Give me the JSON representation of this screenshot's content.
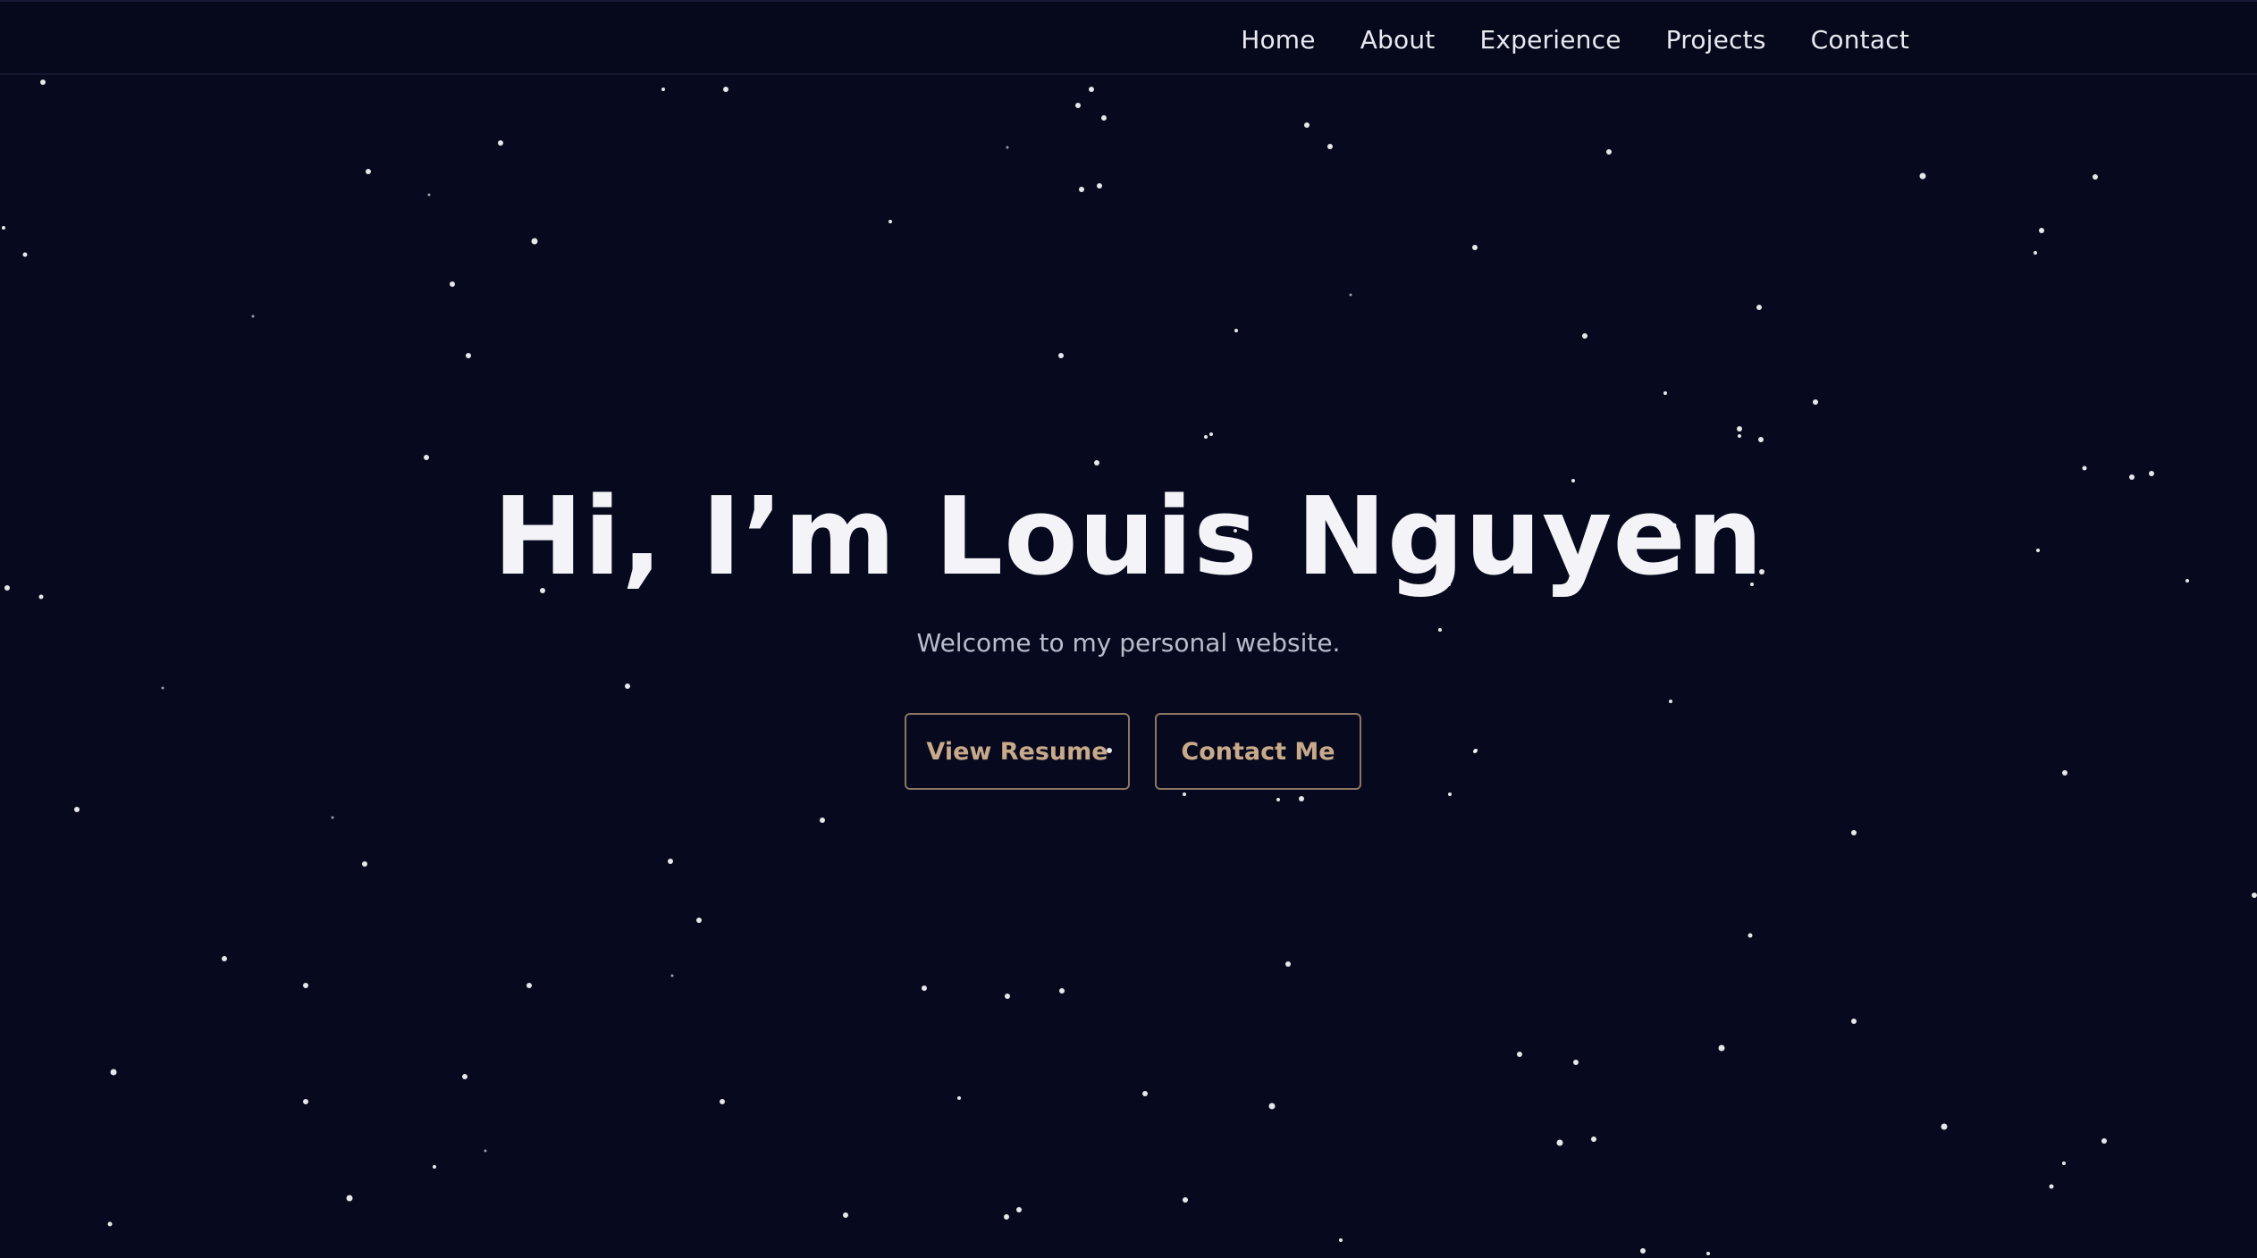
{
  "nav": {
    "items": [
      {
        "label": "Home"
      },
      {
        "label": "About"
      },
      {
        "label": "Experience"
      },
      {
        "label": "Projects"
      },
      {
        "label": "Contact"
      }
    ]
  },
  "hero": {
    "title": "Hi, I’m Louis Nguyen",
    "subtitle": "Welcome to my personal website.",
    "buttons": {
      "resume_label": "View Resume",
      "contact_label": "Contact Me"
    }
  },
  "colors": {
    "background": "#070a1e",
    "text": "#f4f4f8",
    "accent": "#c8a98a",
    "star": "#ffffff"
  }
}
